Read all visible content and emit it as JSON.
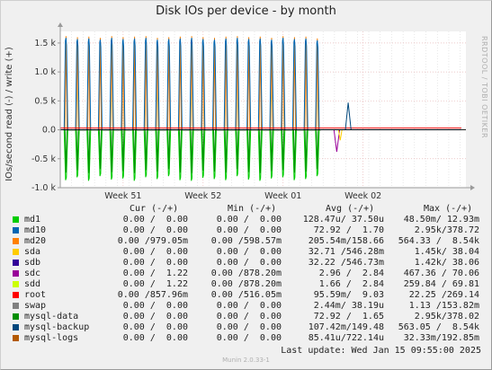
{
  "window": {
    "title": "Disk IOs per device - by month"
  },
  "side_credit": "RRDTOOL / TOBI OETIKER",
  "last_update": "Last update:  Wed Jan 15 09:55:00 2025",
  "footer": "Munin 2.0.33-1",
  "colors": {
    "background": "#f0f0f0",
    "plot_bg": "#ffffff",
    "grid_major": "#e7b8b8",
    "grid_minor": "#d8d8d8",
    "axis": "#9a9a9a"
  },
  "chart_data": {
    "type": "line",
    "title": "Disk IOs per device - by month",
    "ylabel": "IOs/second read (-) / write (+)",
    "ylim": [
      -1000,
      1700
    ],
    "yticks": [
      -1000,
      -500,
      0,
      500,
      1000,
      1500
    ],
    "ytick_labels": [
      "-1.0 k",
      "-0.5 k",
      "0.0",
      "0.5 k",
      "1.0 k",
      "1.5 k"
    ],
    "xticks": [
      "Week 51",
      "Week 52",
      "Week 01",
      "Week 02"
    ],
    "x_domain_days": [
      0,
      35.5
    ],
    "xtick_days": [
      5.5,
      12.5,
      19.5,
      26.5
    ],
    "daily_spikes": {
      "start_day": 0,
      "count": 23,
      "write_peaks": [
        1620,
        1600,
        1610,
        1590,
        1620,
        1600,
        1610,
        1620,
        1590,
        1600,
        1610,
        1620,
        1600,
        1590,
        1610,
        1620,
        1600,
        1610,
        1590,
        1620,
        1600,
        1610,
        1580
      ],
      "read_troughs": [
        -870,
        -820,
        -880,
        -800,
        -860,
        -840,
        -880,
        -820,
        -850,
        -800,
        -870,
        -880,
        -830,
        -850,
        -870,
        -800,
        -860,
        -880,
        -840,
        -820,
        -870,
        -850,
        -800
      ]
    },
    "late_events": [
      {
        "day": 24.2,
        "series": "sdc",
        "value": -380
      },
      {
        "day": 25.2,
        "series": "mysql-backup",
        "value": 470
      }
    ],
    "series": [
      {
        "name": "md1",
        "color": "#00cc00"
      },
      {
        "name": "md10",
        "color": "#0066b3"
      },
      {
        "name": "md20",
        "color": "#ff8000"
      },
      {
        "name": "sda",
        "color": "#ffcc00"
      },
      {
        "name": "sdb",
        "color": "#330099"
      },
      {
        "name": "sdc",
        "color": "#990099"
      },
      {
        "name": "sdd",
        "color": "#ccff00"
      },
      {
        "name": "root",
        "color": "#ff0000"
      },
      {
        "name": "swap",
        "color": "#808080"
      },
      {
        "name": "mysql-data",
        "color": "#008f00"
      },
      {
        "name": "mysql-backup",
        "color": "#00487d"
      },
      {
        "name": "mysql-logs",
        "color": "#b35a00"
      }
    ]
  },
  "legend": {
    "headers": {
      "cur": "Cur (-/+)",
      "min": "Min (-/+)",
      "avg": "Avg (-/+)",
      "max": "Max (-/+)"
    },
    "rows": [
      {
        "name": "md1",
        "cur": "0.00 /  0.00",
        "min": "0.00 /  0.00",
        "avg": "128.47u/ 37.50u",
        "max": "48.50m/ 12.93m"
      },
      {
        "name": "md10",
        "cur": "0.00 /  0.00",
        "min": "0.00 /  0.00",
        "avg": "72.92 /  1.70",
        "max": "2.95k/378.72"
      },
      {
        "name": "md20",
        "cur": "0.00 /979.05m",
        "min": "0.00 /598.57m",
        "avg": "205.54m/158.66",
        "max": "564.33 /  8.54k"
      },
      {
        "name": "sda",
        "cur": "0.00 /  0.00",
        "min": "0.00 /  0.00",
        "avg": "32.71 /546.28m",
        "max": "1.45k/ 38.04"
      },
      {
        "name": "sdb",
        "cur": "0.00 /  0.00",
        "min": "0.00 /  0.00",
        "avg": "32.22 /546.73m",
        "max": "1.42k/ 38.06"
      },
      {
        "name": "sdc",
        "cur": "0.00 /  1.22",
        "min": "0.00 /878.20m",
        "avg": "2.96 /  2.84",
        "max": "467.36 / 70.06"
      },
      {
        "name": "sdd",
        "cur": "0.00 /  1.22",
        "min": "0.00 /878.20m",
        "avg": "1.66 /  2.84",
        "max": "259.84 / 69.81"
      },
      {
        "name": "root",
        "cur": "0.00 /857.96m",
        "min": "0.00 /516.05m",
        "avg": "95.59m/  9.03",
        "max": "22.25 /269.14"
      },
      {
        "name": "swap",
        "cur": "0.00 /  0.00",
        "min": "0.00 /  0.00",
        "avg": "2.44m/ 38.19u",
        "max": "1.13 /153.82m"
      },
      {
        "name": "mysql-data",
        "cur": "0.00 /  0.00",
        "min": "0.00 /  0.00",
        "avg": "72.92 /  1.65",
        "max": "2.95k/378.02"
      },
      {
        "name": "mysql-backup",
        "cur": "0.00 /  0.00",
        "min": "0.00 /  0.00",
        "avg": "107.42m/149.48",
        "max": "563.05 /  8.54k"
      },
      {
        "name": "mysql-logs",
        "cur": "0.00 /  0.00",
        "min": "0.00 /  0.00",
        "avg": "85.41u/722.14u",
        "max": "32.33m/192.85m"
      }
    ]
  }
}
